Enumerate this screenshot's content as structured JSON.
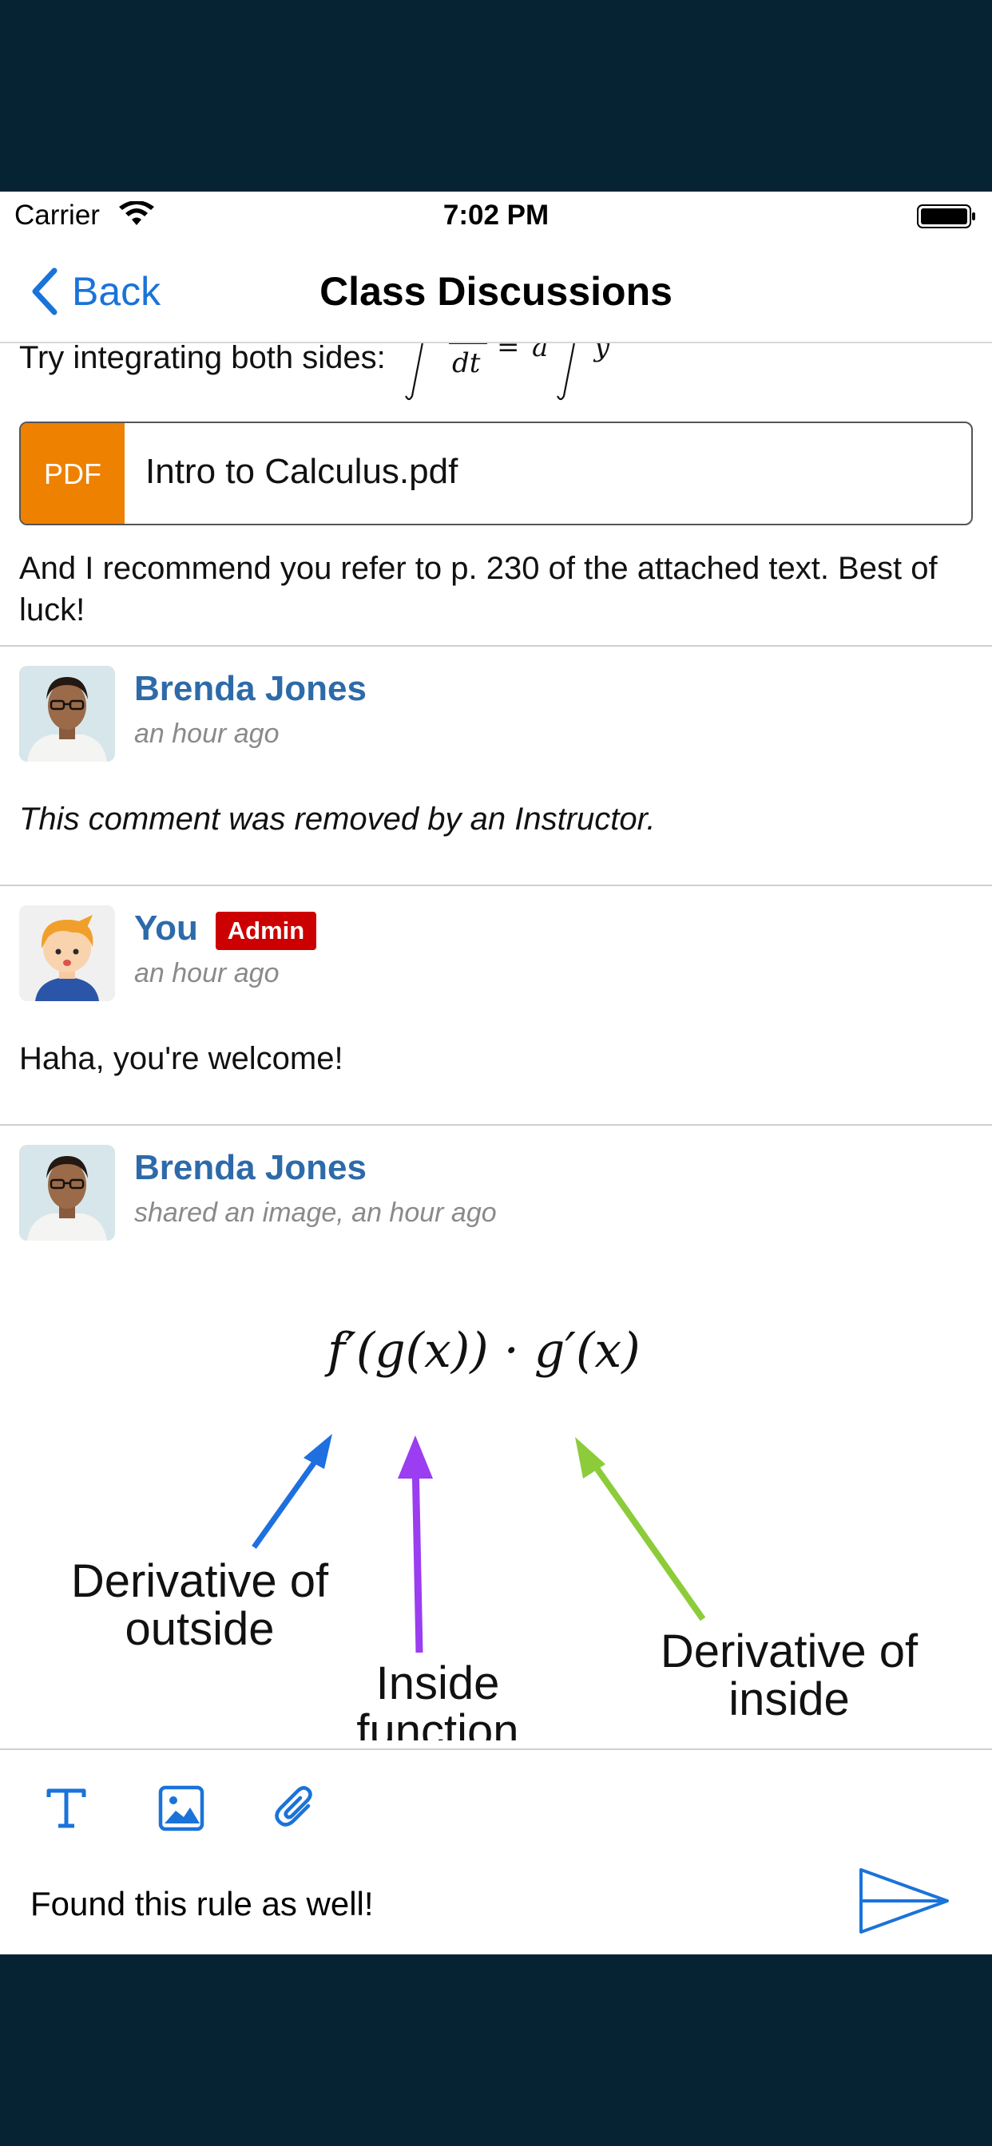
{
  "status_bar": {
    "carrier": "Carrier",
    "time": "7:02 PM"
  },
  "nav": {
    "back_label": "Back",
    "title": "Class Discussions"
  },
  "thread": {
    "partial_message": {
      "text": "Try integrating both sides:",
      "attachment": {
        "badge": "PDF",
        "filename": "Intro to Calculus.pdf",
        "badge_color": "#ee8100"
      },
      "followup": "And I recommend you refer to p. 230 of the attached text. Best of luck!"
    },
    "comments": [
      {
        "author": "Brenda Jones",
        "timestamp": "an hour ago",
        "body": "This comment was removed by an Instructor."
      },
      {
        "author": "You",
        "badge": "Admin",
        "timestamp": "an hour ago",
        "body": "Haha, you're welcome!"
      },
      {
        "author": "Brenda Jones",
        "timestamp": "shared an image, an hour ago",
        "image": {
          "formula": "f′(g(x)) · g′(x)",
          "label_outside": [
            "Derivative of",
            "outside"
          ],
          "label_inside_fn": [
            "Inside",
            "function"
          ],
          "label_inside_deriv": [
            "Derivative of",
            "inside"
          ]
        }
      }
    ]
  },
  "composer": {
    "value": "Found this rule as well!",
    "tools": [
      "text-format-icon",
      "image-icon",
      "attachment-icon"
    ]
  },
  "colors": {
    "accent": "#1a73d9",
    "author": "#2d6aa9",
    "admin_badge": "#cc0000",
    "background_band": "#062334"
  }
}
